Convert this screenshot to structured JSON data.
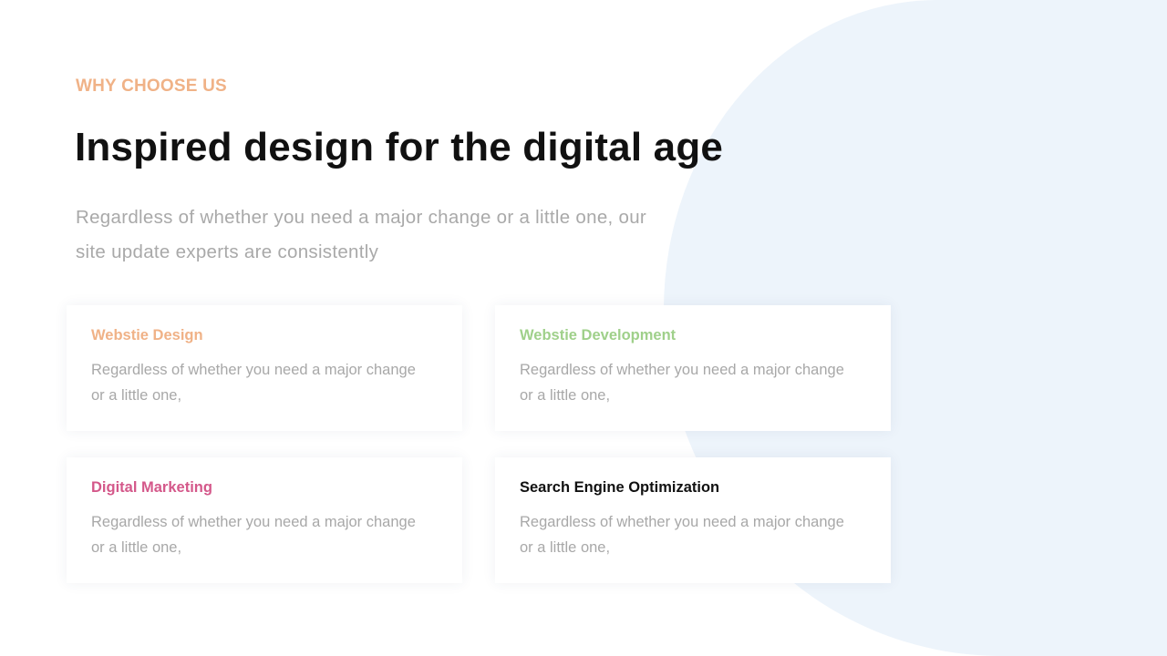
{
  "header": {
    "eyebrow": "WHY CHOOSE US",
    "title": "Inspired design for the digital age",
    "lead": "Regardless of whether you need a major change or a little one, our site update experts are consistently"
  },
  "cards": [
    {
      "title": "Webstie Design",
      "title_color": "#f0b287",
      "text": "Regardless of whether you need a major change or a little one,"
    },
    {
      "title": "Webstie Development",
      "title_color": "#9fd08a",
      "text": "Regardless of whether you need a major change or a little one,"
    },
    {
      "title": "Digital Marketing",
      "title_color": "#d4588a",
      "text": "Regardless of whether you need a major change or a little one,"
    },
    {
      "title": "Search Engine Optimization",
      "title_color": "#111111",
      "text": "Regardless of whether you need a major change or a little one,"
    }
  ],
  "colors": {
    "accent": "#f0b287",
    "background_shape": "#edf4fb",
    "heading": "#111111",
    "body_text": "#a9a9a9"
  }
}
